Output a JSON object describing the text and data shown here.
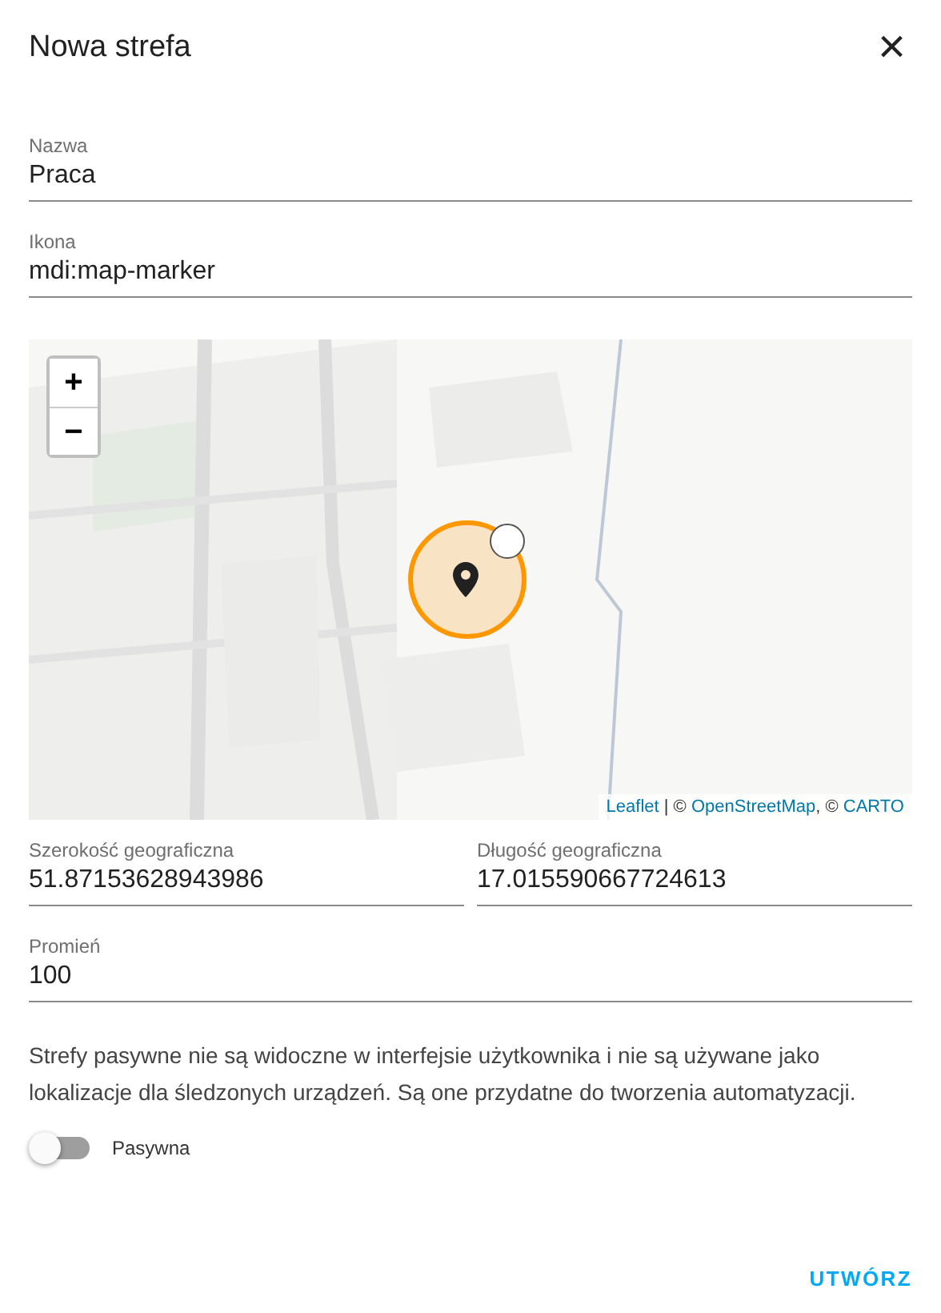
{
  "dialog": {
    "title": "Nowa strefa",
    "close": "×"
  },
  "fields": [
    {
      "label": "Nazwa",
      "value": "Praca"
    },
    {
      "label": "Ikona",
      "value": "mdi:map-marker"
    }
  ],
  "map": {
    "zoom_in": "+",
    "zoom_out": "−",
    "attribution": [
      {
        "kind": "link",
        "text": "Leaflet"
      },
      {
        "kind": "text",
        "text": " | © "
      },
      {
        "kind": "link",
        "text": "OpenStreetMap"
      },
      {
        "kind": "text",
        "text": ", © "
      },
      {
        "kind": "link",
        "text": "CARTO"
      }
    ]
  },
  "coordinates": [
    {
      "label": "Szerokość geograficzna",
      "value": "51.87153628943986"
    },
    {
      "label": "Długość geograficzna",
      "value": "17.015590667724613"
    }
  ],
  "radius": {
    "label": "Promień",
    "value": "100"
  },
  "description": "Strefy pasywne nie są widoczne w interfejsie użytkownika i nie są używane jako lokalizacje dla śledzonych urządzeń. Są one przydatne do tworzenia automatyzacji.",
  "passive": {
    "label": "Pasywna",
    "checked": false
  },
  "buttons": [
    "UTWÓRZ"
  ]
}
